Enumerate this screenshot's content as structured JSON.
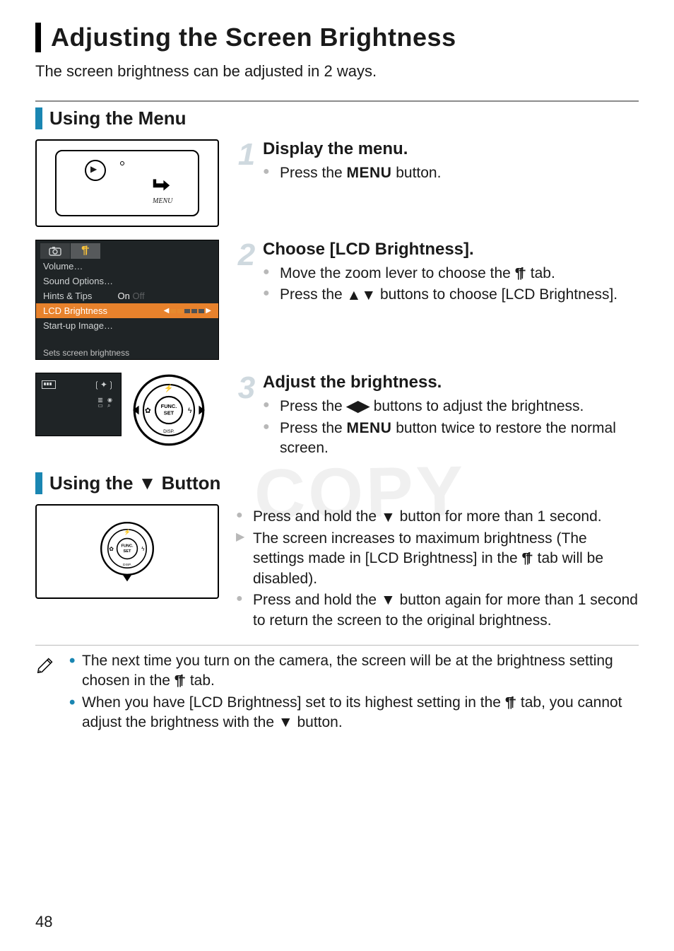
{
  "page_number": "48",
  "watermark": "COPY",
  "title": "Adjusting the Screen Brightness",
  "intro": "The screen brightness can be adjusted in 2 ways.",
  "section_menu": {
    "heading": "Using the Menu",
    "camera_menu_label": "MENU",
    "screenshot": {
      "tab_camera": "camera",
      "tab_tools": "tools",
      "rows": {
        "volume": "Volume…",
        "sound": "Sound Options…",
        "hints": "Hints & Tips",
        "hints_value": "On",
        "lcd": "LCD Brightness",
        "startup": "Start-up Image…"
      },
      "status": "Sets screen brightness"
    },
    "step1": {
      "num": "1",
      "heading": "Display the menu.",
      "line1a": "Press the ",
      "menu_word": "MENU",
      "line1b": " button."
    },
    "step2": {
      "num": "2",
      "heading": "Choose [LCD Brightness].",
      "line1a": "Move the zoom lever to choose the ",
      "line1b": " tab.",
      "line2a": "Press the ",
      "line2b": " buttons to choose [LCD Brightness]."
    },
    "step3": {
      "num": "3",
      "heading": "Adjust the brightness.",
      "line1a": "Press the ",
      "line1b": " buttons to adjust the brightness.",
      "line2a": "Press the ",
      "menu_word": "MENU",
      "line2b": " button twice to restore the normal screen."
    },
    "wheel": {
      "func": "FUNC.",
      "set": "SET",
      "disp": "DISP."
    }
  },
  "section_button": {
    "heading_a": "Using the ",
    "heading_b": " Button",
    "line1a": "Press and hold the ",
    "line1b": " button for more than 1 second.",
    "line2a": "The screen increases to maximum brightness (The settings made in [LCD Brightness] in the ",
    "line2b": " tab will be disabled).",
    "line3a": "Press and hold the ",
    "line3b": " button again for more than 1 second to return the screen to the original brightness."
  },
  "notes": {
    "n1a": "The next time you turn on the camera, the screen will be at the brightness setting chosen in the ",
    "n1b": " tab.",
    "n2a": "When you have [LCD Brightness] set to its highest setting in the ",
    "n2b": " tab, you cannot adjust the brightness with the ",
    "n2c": " button."
  }
}
